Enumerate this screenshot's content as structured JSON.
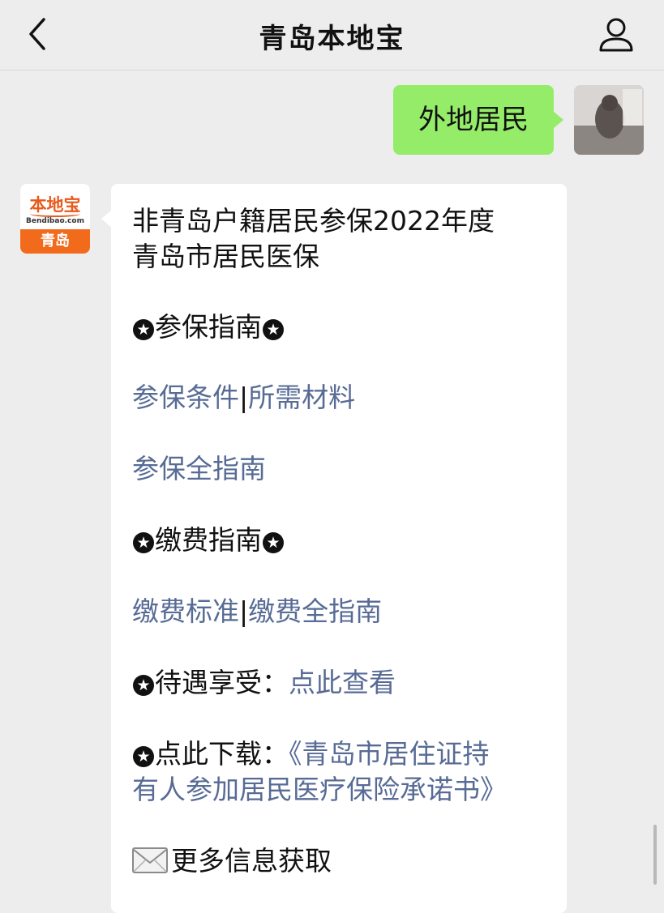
{
  "navbar": {
    "title": "青岛本地宝",
    "back_icon": "chevron-left-icon",
    "profile_icon": "person-icon"
  },
  "user_message": {
    "text": "外地居民"
  },
  "bot": {
    "avatar": {
      "brand": "本地宝",
      "domain": "Bendibao.com",
      "city": "青岛"
    },
    "message": {
      "title_line1": "非青岛户籍居民参保2022年度",
      "title_line2": "青岛市居民医保",
      "section_guide": "参保指南",
      "link_conditions": "参保条件",
      "separator": "|",
      "link_materials": "所需材料",
      "link_full_guide": "参保全指南",
      "section_payment": "缴费指南",
      "link_payment_standard": "缴费标准",
      "link_payment_guide": "缴费全指南",
      "benefits_label": "待遇享受：",
      "benefits_link": "点此查看",
      "download_label": "点此下载：",
      "download_link_line1": "《青岛市居住证持",
      "download_link_line2": "有人参加居民医疗保险承诺书》",
      "more_info": "更多信息获取"
    }
  },
  "colors": {
    "bubble_green": "#95ec69",
    "link": "#576b95",
    "background": "#ededed",
    "brand_orange": "#f26b1d"
  }
}
